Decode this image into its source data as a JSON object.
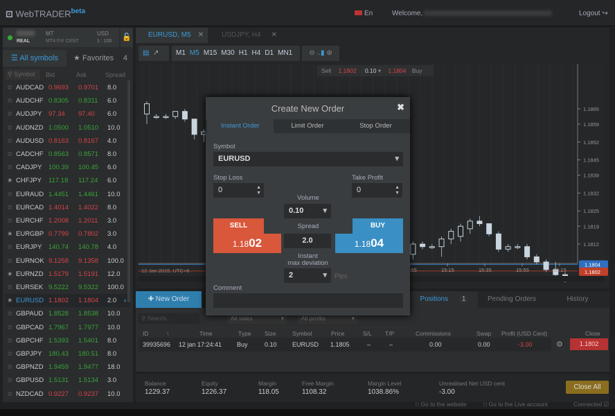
{
  "header": {
    "logo": "WebTRADER",
    "logo_suffix": "beta",
    "lang": "En",
    "welcome": "Welcome,",
    "logout": "Logout"
  },
  "account": {
    "type": "REAL",
    "platform": "MT",
    "server": "MT4 FIX CENT",
    "currency": "USD",
    "leverage": "1 : 100"
  },
  "sidebar": {
    "tab_all": "All symbols",
    "tab_fav": "Favorites",
    "fav_count": "4",
    "columns": [
      "Symbol",
      "Bid",
      "Ask",
      "Spread"
    ],
    "rows": [
      {
        "s": "AUDCAD",
        "b": "0.9693",
        "a": "0.9701",
        "sp": "8.0",
        "dir": "down",
        "fav": false
      },
      {
        "s": "AUDCHF",
        "b": "0.8305",
        "a": "0.8311",
        "sp": "6.0",
        "dir": "up",
        "fav": false
      },
      {
        "s": "AUDJPY",
        "b": "97.34",
        "a": "97.40",
        "sp": "6.0",
        "dir": "down",
        "fav": false
      },
      {
        "s": "AUDNZD",
        "b": "1.0500",
        "a": "1.0510",
        "sp": "10.0",
        "dir": "up",
        "fav": false
      },
      {
        "s": "AUDUSD",
        "b": "0.8163",
        "a": "0.8167",
        "sp": "4.0",
        "dir": "down",
        "fav": false
      },
      {
        "s": "CADCHF",
        "b": "0.8563",
        "a": "0.8571",
        "sp": "8.0",
        "dir": "up",
        "fav": false
      },
      {
        "s": "CADJPY",
        "b": "100.39",
        "a": "100.45",
        "sp": "6.0",
        "dir": "up",
        "fav": false
      },
      {
        "s": "CHFJPY",
        "b": "117.18",
        "a": "117.24",
        "sp": "6.0",
        "dir": "up",
        "fav": true
      },
      {
        "s": "EURAUD",
        "b": "1.4451",
        "a": "1.4461",
        "sp": "10.0",
        "dir": "up",
        "fav": false
      },
      {
        "s": "EURCAD",
        "b": "1.4014",
        "a": "1.4022",
        "sp": "8.0",
        "dir": "down",
        "fav": false
      },
      {
        "s": "EURCHF",
        "b": "1.2008",
        "a": "1.2011",
        "sp": "3.0",
        "dir": "down",
        "fav": false
      },
      {
        "s": "EURGBP",
        "b": "0.7799",
        "a": "0.7802",
        "sp": "3.0",
        "dir": "down",
        "fav": true
      },
      {
        "s": "EURJPY",
        "b": "140.74",
        "a": "140.78",
        "sp": "4.0",
        "dir": "up",
        "fav": false
      },
      {
        "s": "EURNOK",
        "b": "9.1258",
        "a": "9.1358",
        "sp": "100.0",
        "dir": "down",
        "fav": false
      },
      {
        "s": "EURNZD",
        "b": "1.5179",
        "a": "1.5191",
        "sp": "12.0",
        "dir": "down",
        "fav": true
      },
      {
        "s": "EURSEK",
        "b": "9.5222",
        "a": "9.5322",
        "sp": "100.0",
        "dir": "up",
        "fav": false
      },
      {
        "s": "EURUSD",
        "b": "1.1802",
        "a": "1.1804",
        "sp": "2.0",
        "dir": "down",
        "fav": true,
        "selected": true
      },
      {
        "s": "GBPAUD",
        "b": "1.8528",
        "a": "1.8538",
        "sp": "10.0",
        "dir": "up",
        "fav": false
      },
      {
        "s": "GBPCAD",
        "b": "1.7967",
        "a": "1.7977",
        "sp": "10.0",
        "dir": "up",
        "fav": false
      },
      {
        "s": "GBPCHF",
        "b": "1.5393",
        "a": "1.5401",
        "sp": "8.0",
        "dir": "up",
        "fav": false
      },
      {
        "s": "GBPJPY",
        "b": "180.43",
        "a": "180.51",
        "sp": "8.0",
        "dir": "up",
        "fav": false
      },
      {
        "s": "GBPNZD",
        "b": "1.9459",
        "a": "1.9477",
        "sp": "18.0",
        "dir": "up",
        "fav": false
      },
      {
        "s": "GBPUSD",
        "b": "1.5131",
        "a": "1.5134",
        "sp": "3.0",
        "dir": "up",
        "fav": false
      },
      {
        "s": "NZDCAD",
        "b": "0.9227",
        "a": "0.9237",
        "sp": "10.0",
        "dir": "down",
        "fav": false
      }
    ]
  },
  "chart": {
    "tab1": "EURUSD, M5",
    "tab2": "USDJPY, H4",
    "timeframes": [
      "M1",
      "M5",
      "M15",
      "M30",
      "H1",
      "H4",
      "D1",
      "MN1"
    ],
    "active_tf": "M5",
    "oneclick": {
      "sell": "Sell",
      "sell_price": "1.1802",
      "volume": "0.10",
      "buy_price": "1.1804",
      "buy": "Buy"
    },
    "date_label": "12 Jan 2015, UTC+6",
    "time_ticks": [
      "14:55",
      "15:15",
      "15:35",
      "15:55",
      "16:15"
    ],
    "price_ticks": [
      "1.1865",
      "1.1859",
      "1.1852",
      "1.1845",
      "1.1839",
      "1.1832",
      "1.1825",
      "1.1819",
      "1.1812"
    ],
    "ask_tag": "1.1804",
    "bid_tag": "1.1802"
  },
  "chart_data": {
    "type": "candlestick",
    "ylim": [
      1.1795,
      1.1873
    ],
    "candles": [
      [
        1.1863,
        1.1868,
        1.1859,
        1.1867
      ],
      [
        1.1862,
        1.1863,
        1.1861,
        1.1862
      ],
      [
        1.1862,
        1.1863,
        1.1861,
        1.1862
      ],
      [
        1.1862,
        1.1864,
        1.1861,
        1.1864
      ],
      [
        1.1864,
        1.1865,
        1.186,
        1.1861
      ],
      [
        1.1861,
        1.1861,
        1.1853,
        1.1855
      ],
      [
        1.1855,
        1.1857,
        1.1852,
        1.1856
      ],
      [
        1.1855,
        1.1856,
        1.185,
        1.1852
      ],
      [
        1.1852,
        1.1853,
        1.1846,
        1.1848
      ],
      [
        1.1848,
        1.185,
        1.1843,
        1.1845
      ],
      [
        1.1845,
        1.1847,
        1.184,
        1.1842
      ],
      [
        1.1842,
        1.1844,
        1.1836,
        1.1838
      ],
      [
        1.1838,
        1.184,
        1.1832,
        1.1834
      ],
      [
        1.1834,
        1.1837,
        1.1829,
        1.1831
      ],
      [
        1.1831,
        1.1833,
        1.1826,
        1.1828
      ],
      [
        1.1828,
        1.183,
        1.1822,
        1.1825
      ],
      [
        1.1825,
        1.1827,
        1.1819,
        1.1821
      ],
      [
        1.1821,
        1.1824,
        1.1816,
        1.1818
      ],
      [
        1.1818,
        1.1821,
        1.1813,
        1.1816
      ],
      [
        1.1816,
        1.1819,
        1.1811,
        1.1813
      ],
      [
        1.1813,
        1.1817,
        1.1809,
        1.1814
      ],
      [
        1.1814,
        1.1818,
        1.181,
        1.1812
      ],
      [
        1.1812,
        1.1816,
        1.1808,
        1.1811
      ],
      [
        1.1811,
        1.1815,
        1.1808,
        1.1813
      ],
      [
        1.1813,
        1.1817,
        1.181,
        1.1815
      ],
      [
        1.1815,
        1.1816,
        1.1809,
        1.1811
      ],
      [
        1.1811,
        1.1815,
        1.1809,
        1.1814
      ],
      [
        1.1814,
        1.1816,
        1.1806,
        1.1808
      ],
      [
        1.1808,
        1.1813,
        1.1806,
        1.1812
      ],
      [
        1.1812,
        1.1813,
        1.181,
        1.1811
      ],
      [
        1.1811,
        1.1812,
        1.181,
        1.1811
      ],
      [
        1.1811,
        1.1815,
        1.1807,
        1.1814
      ],
      [
        1.1814,
        1.1818,
        1.1812,
        1.1817
      ],
      [
        1.1815,
        1.182,
        1.1813,
        1.1819
      ],
      [
        1.1818,
        1.1822,
        1.1816,
        1.1821
      ],
      [
        1.1821,
        1.1823,
        1.1819,
        1.182
      ],
      [
        1.182,
        1.182,
        1.1815,
        1.1816
      ],
      [
        1.1816,
        1.1817,
        1.1809,
        1.181
      ],
      [
        1.181,
        1.1812,
        1.1809,
        1.1811
      ],
      [
        1.1811,
        1.1812,
        1.181,
        1.1811
      ],
      [
        1.1811,
        1.1812,
        1.1806,
        1.1807
      ],
      [
        1.1807,
        1.1808,
        1.1804,
        1.1805
      ],
      [
        1.1805,
        1.1806,
        1.1801,
        1.1802
      ],
      [
        1.1802,
        1.1805,
        1.1799,
        1.18
      ],
      [
        1.18,
        1.1801,
        1.1797,
        1.1798
      ]
    ]
  },
  "modal": {
    "title": "Create New Order",
    "tabs": [
      "Instant Order",
      "Limit Order",
      "Stop Order"
    ],
    "symbol_label": "Symbol",
    "symbol": "EURUSD",
    "sl_label": "Stop Loss",
    "sl": "0",
    "tp_label": "Take Profit",
    "tp": "0",
    "volume_label": "Volume",
    "volume": "0.10",
    "sell_label": "SELL",
    "sell_pre": "1.18",
    "sell_big": "02",
    "buy_label": "BUY",
    "buy_pre": "1.18",
    "buy_big": "04",
    "spread_label": "Spread",
    "spread": "2.0",
    "dev_label1": "Instant",
    "dev_label2": "max deviation",
    "deviation": "2",
    "pips": "Pips",
    "comment_label": "Comment",
    "comment": ""
  },
  "bottom": {
    "new_order": "New Order",
    "tabs": [
      "Positions",
      "Pending Orders",
      "History"
    ],
    "pos_count": "1",
    "search_placeholder": "Search...",
    "sides": "All sides",
    "profits": "All profits",
    "columns": [
      "ID",
      "Time",
      "Type",
      "Size",
      "Symbol",
      "Price",
      "S/L",
      "T/P",
      "Commissions",
      "Swap",
      "Profit (USD Cent)",
      "Close"
    ],
    "position": {
      "id": "39935696",
      "time": "12 jan 17:24:41",
      "type": "Buy",
      "size": "0.10",
      "symbol": "EURUSD",
      "price": "1.1805",
      "sl": "–",
      "tp": "–",
      "comm": "0.00",
      "swap": "0.00",
      "profit": "-3.00",
      "close": "1.1802"
    }
  },
  "summary": {
    "balance_l": "Balance",
    "balance": "1229.37",
    "equity_l": "Equity",
    "equity": "1226.37",
    "margin_l": "Margin",
    "margin": "118.05",
    "free_l": "Free Margin",
    "free": "1108.32",
    "level_l": "Margin Level",
    "level": "1038.86%",
    "unreal_l": "Unrealised Net USD cent",
    "unreal": "-3.00",
    "close_all": "Close All"
  },
  "footer": {
    "website": "Go to the website",
    "live": "Go to the Live account",
    "connected": "Connected"
  },
  "colors": {
    "accent": "#3d9ad8",
    "sell": "#d9573a",
    "buy": "#3a8fc4",
    "gold": "#8a6d1e"
  }
}
